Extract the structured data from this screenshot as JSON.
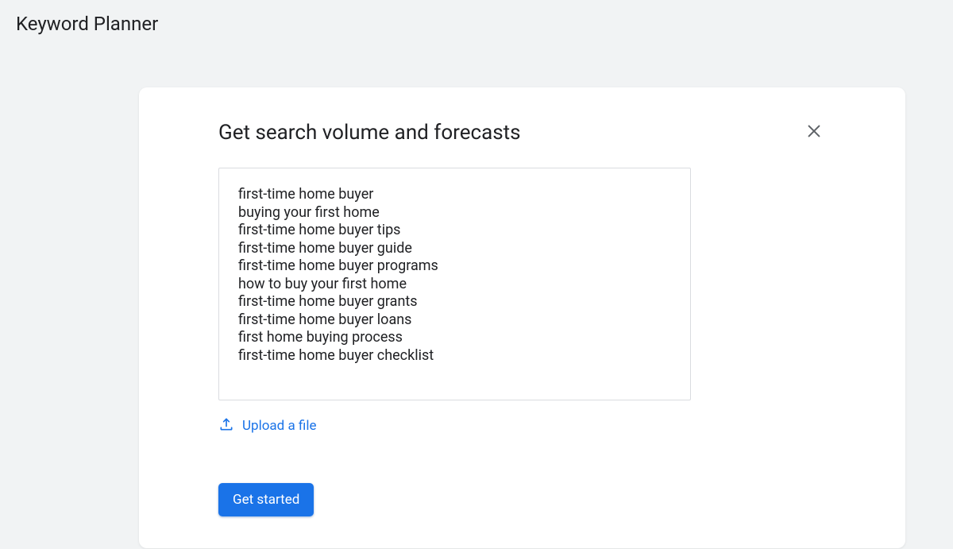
{
  "header": {
    "title": "Keyword Planner"
  },
  "card": {
    "title": "Get search volume and forecasts",
    "keywords": "first-time home buyer\nbuying your first home\nfirst-time home buyer tips\nfirst-time home buyer guide\nfirst-time home buyer programs\nhow to buy your first home\nfirst-time home buyer grants\nfirst-time home buyer loans\nfirst home buying process\nfirst-time home buyer checklist",
    "upload_label": "Upload a file",
    "get_started_label": "Get started"
  }
}
